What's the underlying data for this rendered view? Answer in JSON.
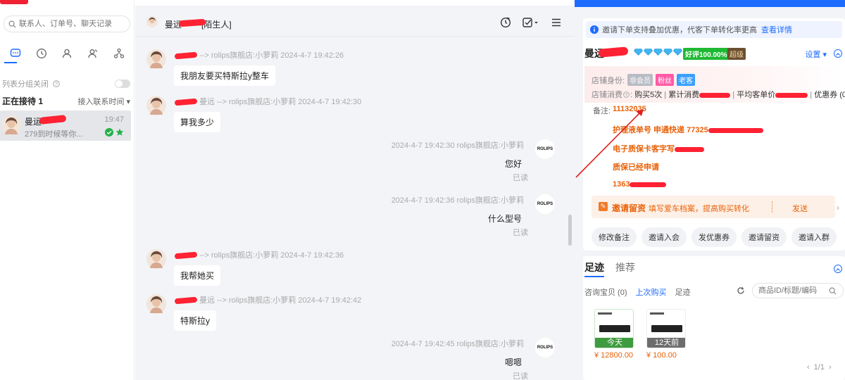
{
  "left": {
    "search_placeholder": "联系人、订单号、聊天记录",
    "group_toggle_label": "列表分组关闭",
    "waiting_title": "正在接待 1",
    "sort_label": "接入联系时间 ▾",
    "contact": {
      "name": "曼运",
      "time": "19:47",
      "preview": "279到时候等你..."
    }
  },
  "chat": {
    "header_title": "曼远",
    "header_tag": "[陌生人]",
    "messages": [
      {
        "meta": "--> rolips旗舰店:小萝莉   2024-4-7 19:42:26",
        "text": "我朋友要买特斯拉y整车"
      },
      {
        "meta": "曼远   --> rolips旗舰店:小萝莉   2024-4-7 19:42:30",
        "text": "算我多少"
      },
      {
        "meta": "2024-4-7 19:42:30  rolips旗舰店:小萝莉",
        "text": "您好",
        "read": "已读",
        "avatar_text": "ROLIPS"
      },
      {
        "meta": "2024-4-7 19:42:36  rolips旗舰店:小萝莉",
        "text": "什么型号",
        "read": "已读",
        "avatar_text": "ROLIPS"
      },
      {
        "meta": "--> rolips旗舰店:小萝莉   2024-4-7 19:42:36",
        "text": "我帮她买"
      },
      {
        "meta": "曼远   --> rolips旗舰店:小萝莉   2024-4-7 19:42:42",
        "text": "特斯拉y"
      },
      {
        "meta": "2024-4-7 19:42:45  rolips旗舰店:小萝莉",
        "text": "嗯嗯",
        "read": "已读",
        "avatar_text": "ROLIPS"
      }
    ]
  },
  "right": {
    "banner_text": "邀请下单支持叠加优惠，代客下单转化率更高",
    "banner_link": "查看详情",
    "customer_name": "曼远",
    "rating": "好评100.00%",
    "level": "超级",
    "settings_label": "设置 ▾",
    "shop_identity_label": "店铺身份:",
    "identity_tags": [
      "非会员",
      "粉丝",
      "老客"
    ],
    "shop_consume_label": "店铺消费",
    "purchase_count": "购买5次",
    "total_spend_label": "累计消费",
    "avg_price_label": "平均客单价",
    "coupon_label": "优惠券 (0)",
    "note_label": "备注:",
    "notes": [
      "11132035",
      "护理液单号 申通快递 77325",
      "电子质保卡客字写",
      "质保已经申请",
      "1363"
    ],
    "invite_title": "邀请留资",
    "invite_desc": "填写爱车档案，提高购买转化",
    "invite_send": "发送",
    "actions": [
      "修改备注",
      "邀请入会",
      "发优惠券",
      "邀请留资",
      "邀请入群"
    ],
    "tabs": [
      "足迹",
      "推荐"
    ],
    "subtabs": [
      "咨询宝贝 (0)",
      "上次购买",
      "足迹"
    ],
    "product_search_placeholder": "商品ID/标题/编码",
    "products": [
      {
        "band": "今天",
        "price": "¥ 12800.00"
      },
      {
        "band": "12天前",
        "price": "¥ 100.00"
      }
    ],
    "pager": "1/1"
  },
  "colors": {
    "accent": "#1d6cff",
    "redaction": "#ff2233",
    "orange": "#e8620a",
    "green": "#1fb833"
  }
}
